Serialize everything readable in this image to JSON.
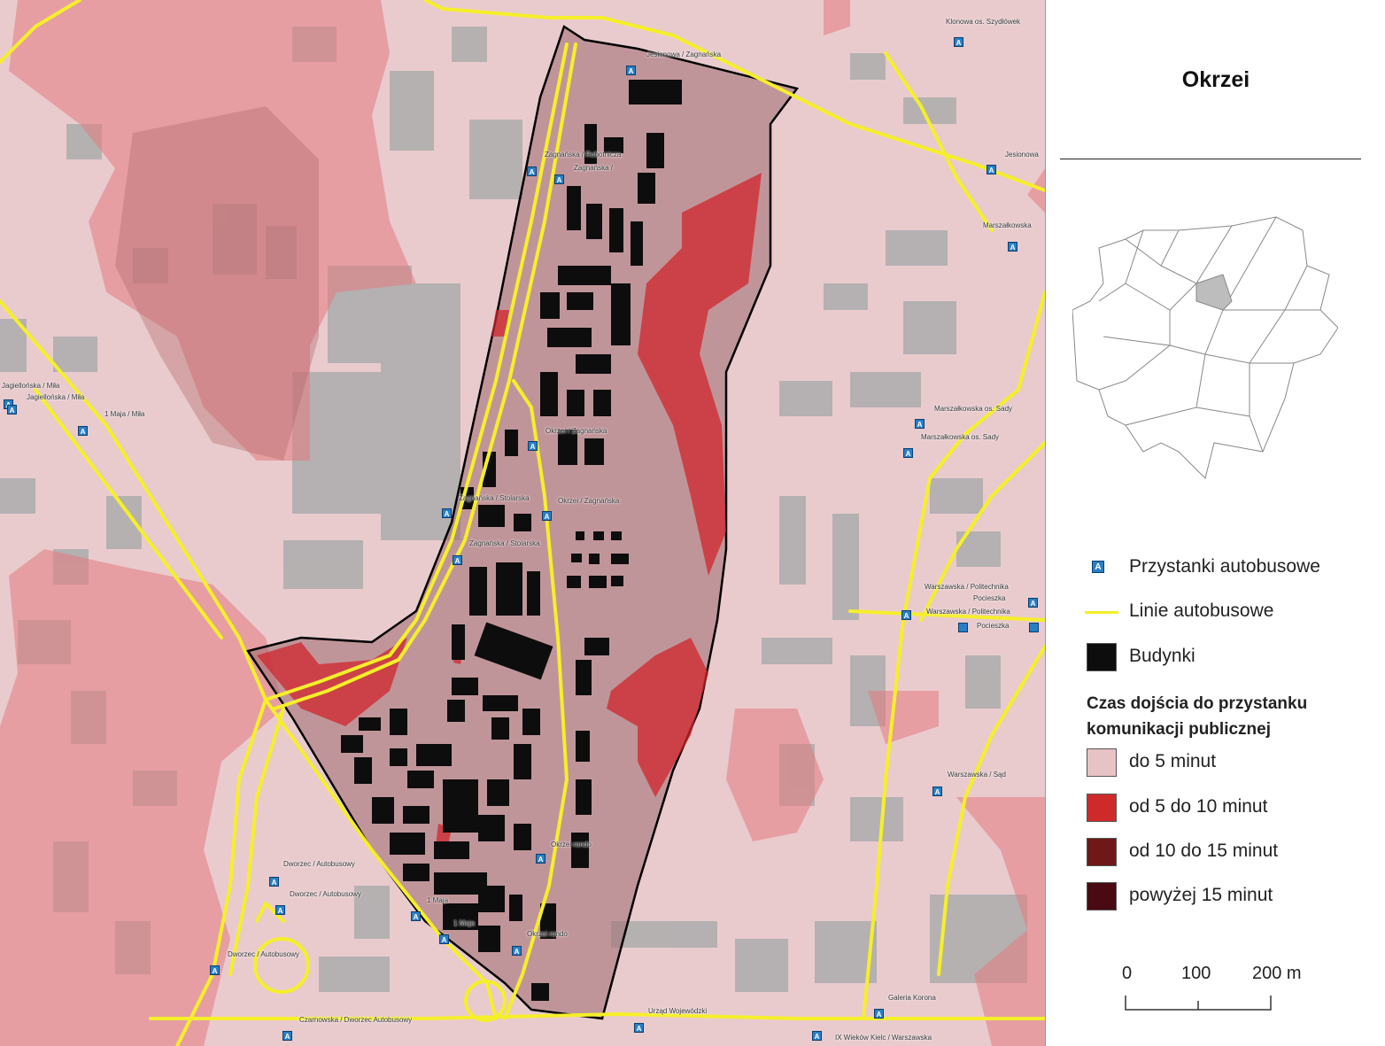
{
  "panel": {
    "title": "Okrzei",
    "legend": {
      "stops_label": "Przystanki autobusowe",
      "lines_label": "Linie autobusowe",
      "buildings_label": "Budynki",
      "time_heading": "Czas dojścia do przystanku komunikacji publicznej",
      "classes": [
        {
          "label": "do 5 minut",
          "color": "#e8c3c6"
        },
        {
          "label": "od 5 do 10 minut",
          "color": "#cf2a2a"
        },
        {
          "label": "od 10 do 15 minut",
          "color": "#6e1818"
        },
        {
          "label": "powyżej 15 minut",
          "color": "#4a0a14"
        }
      ]
    },
    "scale": {
      "labels": [
        "0",
        "100",
        "200 m"
      ]
    }
  },
  "colors": {
    "stop": "#2a7fc4",
    "bus_line": "#f5ef2a",
    "building": "#0d0d0d"
  },
  "stops": [
    {
      "icon": "A",
      "label": "Klonowa os. Szydłówek"
    },
    {
      "icon": "A",
      "label": "Jesionowa / Zagnańska"
    },
    {
      "icon": "A",
      "label": "Jesionowa"
    },
    {
      "icon": "A",
      "label": "Zagnańska / Robotnicza"
    },
    {
      "icon": "A",
      "label": "Zagnańska /"
    },
    {
      "icon": "A",
      "label": "Marszałkowska"
    },
    {
      "icon": "A",
      "label": "Jagiellońska / Miła"
    },
    {
      "icon": "A",
      "label": "Jagiellońska / Miła"
    },
    {
      "icon": "A",
      "label": "1 Maja / Miła"
    },
    {
      "icon": "A",
      "label": "Marszałkowska os. Sady"
    },
    {
      "icon": "A",
      "label": "Marszałkowska os. Sady"
    },
    {
      "icon": "A",
      "label": "Okrzei / Zagnańska"
    },
    {
      "icon": "A",
      "label": "Zagnańska / Stolarska"
    },
    {
      "icon": "A",
      "label": "Okrzei / Zagnańska"
    },
    {
      "icon": "A",
      "label": "Zagnańska / Stolarska"
    },
    {
      "icon": "A",
      "label": "Warszawska / Politechnika"
    },
    {
      "icon": "A",
      "label": "Pocieszka"
    },
    {
      "icon": "A",
      "label": "Warszawska / Politechnika"
    },
    {
      "icon": "A",
      "label": "Pocieszka"
    },
    {
      "icon": "A",
      "label": "Warszawska / Sąd"
    },
    {
      "icon": "A",
      "label": "Okrzei rondo"
    },
    {
      "icon": "A",
      "label": "Dworzec / Autobusowy"
    },
    {
      "icon": "A",
      "label": "Dworzec / Autobusowy"
    },
    {
      "icon": "A",
      "label": "1 Maja"
    },
    {
      "icon": "A",
      "label": "1 Maja"
    },
    {
      "icon": "A",
      "label": "Okrzei rondo"
    },
    {
      "icon": "A",
      "label": "Dworzec / Autobusowy"
    },
    {
      "icon": "A",
      "label": "Urząd Wojewódzki"
    },
    {
      "icon": "A",
      "label": "Galeria Korona"
    },
    {
      "icon": "A",
      "label": "Czarnowska / Dworzec Autobusowy"
    },
    {
      "icon": "A",
      "label": "IX Wieków Kielc / Warszawska"
    }
  ]
}
